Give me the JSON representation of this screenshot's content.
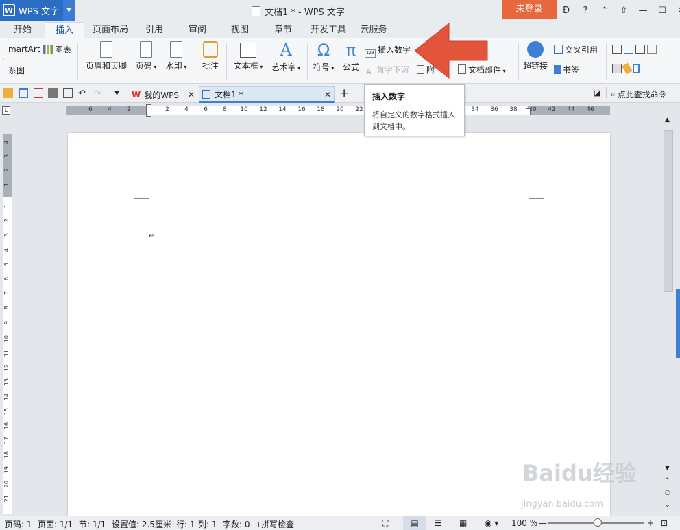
{
  "titlebar": {
    "app_name": "WPS 文字",
    "window_title": "文档1 * - WPS 文字",
    "login_label": "未登录",
    "help_label": "?"
  },
  "menu_tabs": [
    "开始",
    "插入",
    "页面布局",
    "引用",
    "审阅",
    "视图",
    "章节",
    "开发工具",
    "云服务"
  ],
  "active_tab": "插入",
  "ribbon": {
    "smartart_label": "martArt",
    "chart_label": "图表",
    "relation_label": "系图",
    "header_footer_label": "页眉和页脚",
    "page_num_label": "页码",
    "watermark_label": "水印",
    "comment_label": "批注",
    "textbox_label": "文本框",
    "wordart_label": "艺术字",
    "symbol_label": "符号",
    "formula_label": "公式",
    "insert_number_label": "插入数字",
    "dropcap_label": "首字下沉",
    "attach_label": "附",
    "docpart_label": "文档部件",
    "crossref_label": "交叉引用",
    "hyperlink_label": "超链接",
    "bookmark_label": "书签"
  },
  "tabbar": {
    "mywps_label": "我的WPS",
    "doc_tab_label": "文档1 *",
    "find_command_label": "点此查找命令"
  },
  "tooltip": {
    "title": "插入数字",
    "description": "将自定义的数字格式插入到文档中。"
  },
  "hruler_ticks": [
    "6",
    "4",
    "2",
    "2",
    "4",
    "6",
    "8",
    "10",
    "12",
    "14",
    "16",
    "18",
    "20",
    "22",
    "34",
    "36",
    "38",
    "40",
    "42",
    "44",
    "46"
  ],
  "vruler_ticks": [
    "4",
    "3",
    "2",
    "1",
    "1",
    "2",
    "3",
    "4",
    "5",
    "6",
    "7",
    "8",
    "9",
    "10",
    "11",
    "12",
    "13",
    "14",
    "15",
    "16",
    "17",
    "18",
    "19",
    "20",
    "21",
    "22"
  ],
  "document": {
    "paragraph_mark": "↵"
  },
  "statusbar": {
    "page_code": "页码: 1",
    "page": "页面: 1/1",
    "section": "节: 1/1",
    "setting": "设置值: 2.5厘米",
    "row": "行: 1",
    "col": "列: 1",
    "word_count": "字数: 0",
    "spellcheck": "拼写检查",
    "zoom": "100 %"
  },
  "watermark": {
    "brand": "Baidu经验",
    "url": "jingyan.baidu.com"
  },
  "colors": {
    "accent_blue": "#2b6cc4",
    "login_orange": "#e6683c",
    "arrow_red": "#e2553a"
  }
}
